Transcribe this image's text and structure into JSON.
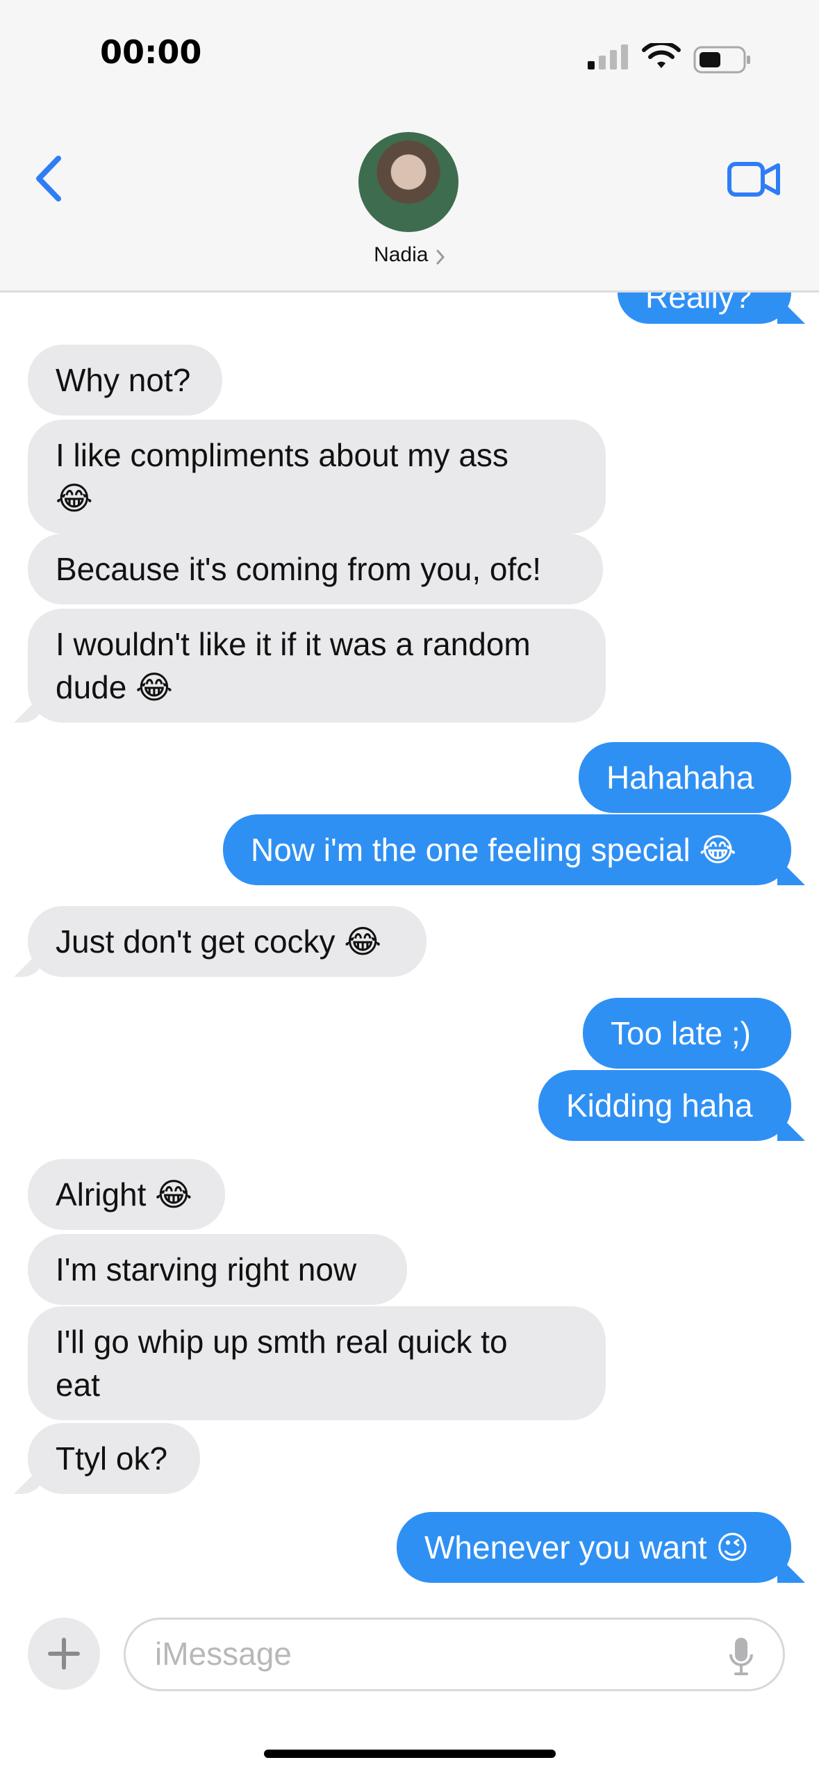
{
  "status_bar": {
    "time": "00:00"
  },
  "header": {
    "contact_name": "Nadia"
  },
  "messages": [
    {
      "text": "Really?",
      "from": "me"
    },
    {
      "text": "Why not?",
      "from": "them"
    },
    {
      "text": "I like compliments about my ass\n😂",
      "from": "them"
    },
    {
      "text": "Because it's coming from you, ofc!",
      "from": "them"
    },
    {
      "text": "I wouldn't like it if it was a random\ndude 😂",
      "from": "them"
    },
    {
      "text": "Hahahaha",
      "from": "me"
    },
    {
      "text": "Now i'm the one feeling special 😂",
      "from": "me"
    },
    {
      "text": "Just don't get cocky 😂",
      "from": "them"
    },
    {
      "text": "Too late ;)",
      "from": "me"
    },
    {
      "text": "Kidding haha",
      "from": "me"
    },
    {
      "text": "Alright 😂",
      "from": "them"
    },
    {
      "text": "I'm starving right now",
      "from": "them"
    },
    {
      "text": "I'll go whip up smth real quick to\neat",
      "from": "them"
    },
    {
      "text": "Ttyl ok?",
      "from": "them"
    },
    {
      "text": "Whenever you want 😉",
      "from": "me"
    }
  ],
  "input": {
    "placeholder": "iMessage"
  },
  "icons": {
    "back": "chevron-left-icon",
    "video": "video-camera-icon",
    "plus": "plus-icon",
    "mic": "microphone-icon"
  },
  "colors": {
    "accent": "#2f90f4",
    "incoming_bubble": "#e9e9eb"
  }
}
